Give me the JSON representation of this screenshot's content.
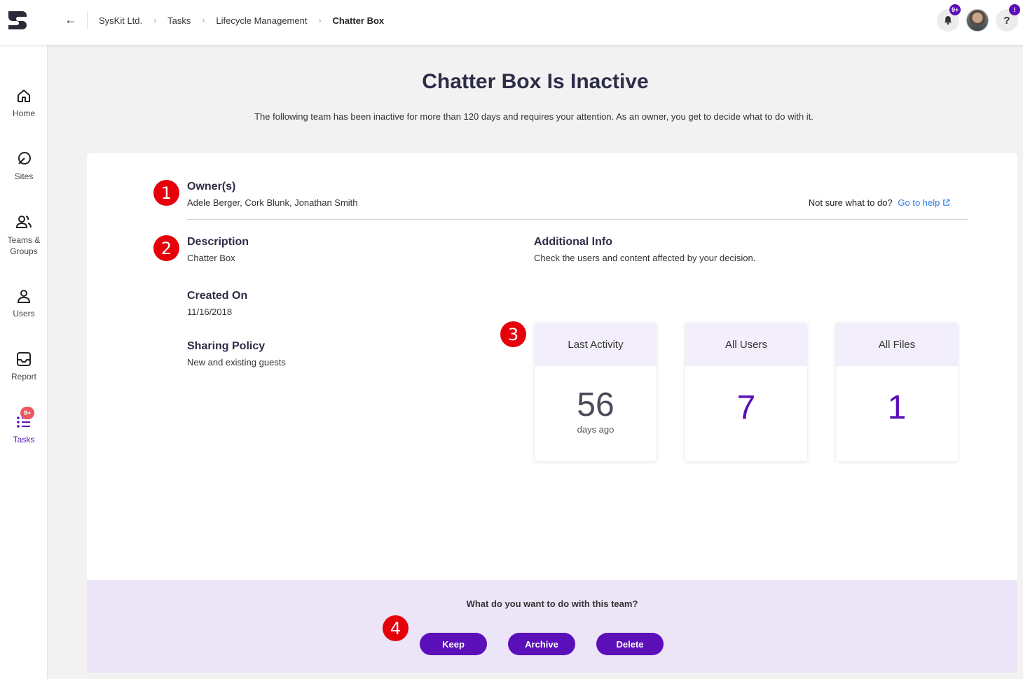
{
  "breadcrumb": [
    "SysKit Ltd.",
    "Tasks",
    "Lifecycle Management",
    "Chatter Box"
  ],
  "notifications": {
    "badge": "9+"
  },
  "help": {
    "icon_text": "?",
    "badge": "!"
  },
  "sidebar": {
    "items": [
      {
        "label": "Home",
        "icon": "home-icon"
      },
      {
        "label": "Sites",
        "icon": "sites-icon"
      },
      {
        "label": "Teams & Groups",
        "icon": "teams-icon"
      },
      {
        "label": "Users",
        "icon": "user-icon"
      },
      {
        "label": "Report",
        "icon": "report-icon"
      },
      {
        "label": "Tasks",
        "icon": "tasks-icon",
        "badge": "9+",
        "active": true
      }
    ]
  },
  "page": {
    "title_name": "Chatter Box",
    "title_status": "Is Inactive",
    "subtitle": "The following team has been inactive for more than 120 days and requires your attention. As an owner, you get to decide what to do with it."
  },
  "details": {
    "owners_label": "Owner(s)",
    "owners_value": "Adele Berger, Cork Blunk, Jonathan Smith",
    "help_question": "Not sure what to do?",
    "help_link": "Go to help",
    "description_label": "Description",
    "description_value": "Chatter Box",
    "created_label": "Created On",
    "created_value": "11/16/2018",
    "sharing_label": "Sharing Policy",
    "sharing_value": "New and existing guests",
    "additional_label": "Additional Info",
    "additional_value": "Check the users and content affected by your decision."
  },
  "steps": [
    "1",
    "2",
    "3",
    "4"
  ],
  "stats": [
    {
      "label": "Last Activity",
      "value": "56",
      "unit": "days ago"
    },
    {
      "label": "All Users",
      "value": "7"
    },
    {
      "label": "All Files",
      "value": "1"
    }
  ],
  "footer": {
    "question": "What do you want to do with this team?",
    "keep": "Keep",
    "archive": "Archive",
    "delete": "Delete"
  },
  "colors": {
    "accent": "#5a0fb8",
    "step_marker": "#e5000a",
    "footer_bg": "#ece4f7",
    "link": "#2a7de1"
  }
}
